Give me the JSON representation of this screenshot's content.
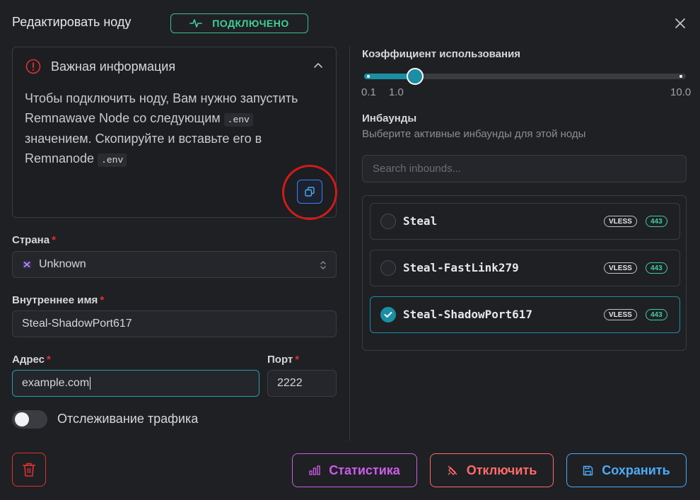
{
  "header": {
    "title": "Редактировать ноду",
    "status_badge": "ПОДКЛЮЧЕНО"
  },
  "info": {
    "title": "Важная информация",
    "text_part1": "Чтобы подключить ноду, Вам нужно запустить Remnawave Node со следующим ",
    "code1": ".env",
    "text_part2": " значением. Скопируйте и вставьте его в Remnanode ",
    "code2": ".env"
  },
  "form": {
    "country_label": "Страна",
    "country_value": "Unknown",
    "name_label": "Внутреннее имя",
    "name_value": "Steal-ShadowPort617",
    "address_label": "Адрес",
    "address_value": "example.com",
    "port_label": "Порт",
    "port_value": "2222",
    "required_mark": "*",
    "traffic_label": "Отслеживание трафика",
    "traffic_enabled": false
  },
  "usage": {
    "title": "Коэффициент использования",
    "min_label": "0.1",
    "value_label": "1.0",
    "max_label": "10.0",
    "value": 1.0,
    "min": 0.1,
    "max": 10.0
  },
  "inbounds": {
    "title": "Инбаунды",
    "description": "Выберите активные инбаунды для этой ноды",
    "search_placeholder": "Search inbounds...",
    "items": [
      {
        "name": "Steal",
        "protocol": "VLESS",
        "port": "443",
        "checked": false
      },
      {
        "name": "Steal-FastLink279",
        "protocol": "VLESS",
        "port": "443",
        "checked": false
      },
      {
        "name": "Steal-ShadowPort617",
        "protocol": "VLESS",
        "port": "443",
        "checked": true
      }
    ]
  },
  "footer": {
    "stats_label": "Статистика",
    "disable_label": "Отключить",
    "save_label": "Сохранить"
  },
  "colors": {
    "accent": "#1b8ea3",
    "status_green": "#3fd09a",
    "danger": "#e03131",
    "purple": "#cc5de8",
    "blue": "#4dabf7"
  }
}
